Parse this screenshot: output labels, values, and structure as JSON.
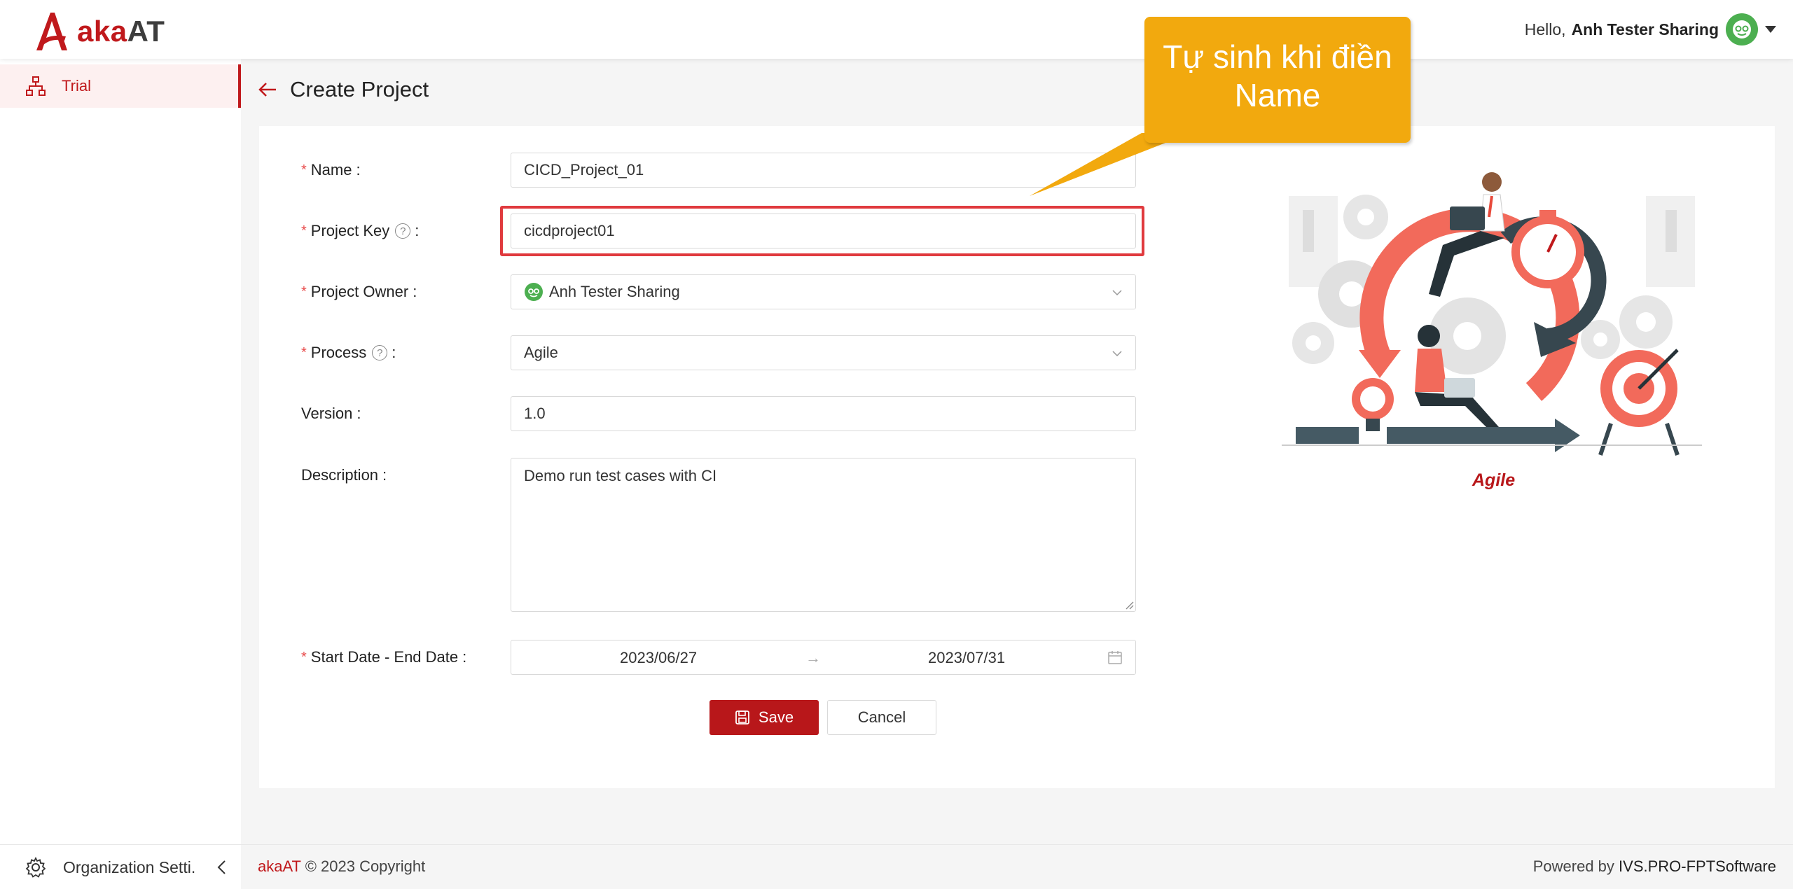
{
  "header": {
    "logo_aka": "aka",
    "logo_at": "AT",
    "hello": "Hello,",
    "user_name": "Anh Tester Sharing"
  },
  "sidebar": {
    "items": [
      {
        "label": "Trial",
        "icon": "sitemap-icon"
      }
    ],
    "footer_label": "Organization Setti..."
  },
  "page": {
    "title": "Create Project"
  },
  "form": {
    "name_label": "Name",
    "name_value": "CICD_Project_01",
    "key_label": "Project Key",
    "key_value": "cicdproject01",
    "owner_label": "Project Owner",
    "owner_value": "Anh Tester Sharing",
    "process_label": "Process",
    "process_value": "Agile",
    "version_label": "Version",
    "version_value": "1.0",
    "description_label": "Description",
    "description_value": "Demo run test cases with CI",
    "dates_label": "Start Date - End Date",
    "start_date": "2023/06/27",
    "date_arrow": "→",
    "end_date": "2023/07/31",
    "required_mark": "*",
    "colon": ":",
    "help_mark": "?",
    "save_label": "Save",
    "cancel_label": "Cancel"
  },
  "illustration": {
    "caption": "Agile"
  },
  "callout": {
    "line1": "Tự sinh khi điền",
    "line2": "Name"
  },
  "footer": {
    "brand": "akaAT",
    "copyright": "© 2023 Copyright",
    "powered_prefix": "Powered by",
    "powered_name": "IVS.PRO-FPTSoftware"
  },
  "colors": {
    "brand": "#c0191c",
    "save_button": "#b8171a",
    "callout": "#f2a90e",
    "highlight_border": "#e03a3e"
  }
}
